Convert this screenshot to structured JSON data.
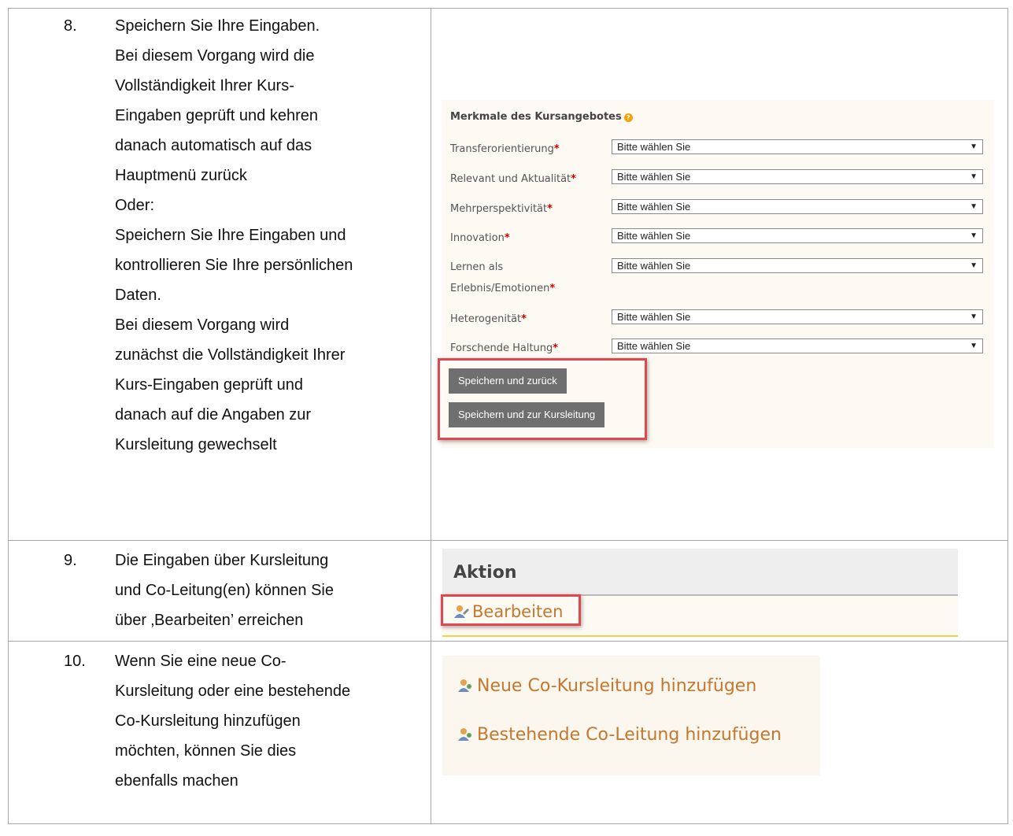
{
  "rows": [
    {
      "num": "8.",
      "lines": [
        "Speichern Sie Ihre Eingaben.",
        "Bei diesem Vorgang wird die",
        "Vollständigkeit Ihrer Kurs-",
        "Eingaben geprüft und kehren",
        "danach automatisch auf das",
        "Hauptmenü zurück",
        "Oder:",
        "Speichern Sie Ihre Eingaben und",
        "kontrollieren Sie Ihre persönlichen",
        "Daten.",
        "Bei diesem Vorgang wird",
        "zunächst die Vollständigkeit Ihrer",
        "Kurs-Eingaben geprüft und",
        "danach auf die Angaben zur",
        "Kursleitung gewechselt"
      ]
    },
    {
      "num": "9.",
      "lines": [
        "Die Eingaben über Kursleitung",
        "und Co-Leitung(en) können Sie",
        "über ‚Bearbeiten’ erreichen"
      ]
    },
    {
      "num": "10.",
      "lines": [
        "Wenn Sie eine neue Co-",
        "Kursleitung oder eine bestehende",
        "Co-Kursleitung hinzufügen",
        "möchten, können Sie dies",
        "ebenfalls machen"
      ]
    }
  ],
  "merkmale": {
    "title": "Merkmale des Kursangebotes",
    "info_icon": "info-icon",
    "required_marker": "*",
    "fields": [
      {
        "label": "Transferorientierung",
        "value": "Bitte wählen Sie"
      },
      {
        "label": "Relevant und Aktualität",
        "value": "Bitte wählen Sie"
      },
      {
        "label": "Mehrperspektivität",
        "value": "Bitte wählen Sie"
      },
      {
        "label": "Innovation",
        "value": "Bitte wählen Sie"
      },
      {
        "label_line1": "Lernen als",
        "label_line2": "Erlebnis/Emotionen",
        "value": "Bitte wählen Sie"
      },
      {
        "label": "Heterogenität",
        "value": "Bitte wählen Sie"
      },
      {
        "label": "Forschende Haltung",
        "value": "Bitte wählen Sie"
      }
    ],
    "btn_save_back": "Speichern und zurück",
    "btn_save_leader": "Speichern und zur Kursleitung"
  },
  "aktion": {
    "header": "Aktion",
    "edit_link": "Bearbeiten"
  },
  "co": {
    "new_link": "Neue Co-Kursleitung hinzufügen",
    "existing_link": "Bestehende Co-Leitung hinzufügen"
  },
  "colors": {
    "highlight": "#e0474e",
    "link": "#c3782e",
    "button": "#6f6f6f"
  }
}
